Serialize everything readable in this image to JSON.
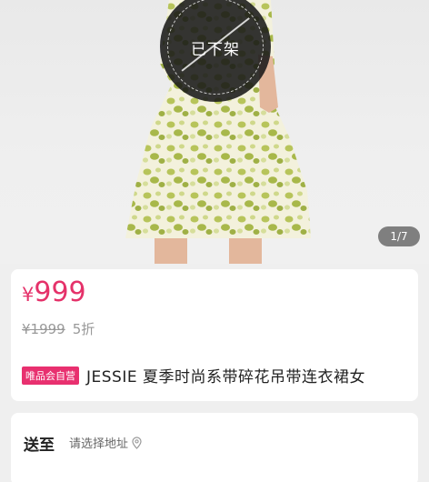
{
  "gallery": {
    "status_stamp": "已下架",
    "counter": "1/7"
  },
  "price": {
    "currency": "¥",
    "current": "999",
    "original": "¥1999",
    "discount": "5折"
  },
  "product": {
    "badge": "唯品会自营",
    "title": "JESSIE 夏季时尚系带碎花吊带连衣裙女"
  },
  "shipping": {
    "label": "送至",
    "address_placeholder": "请选择地址"
  },
  "colors": {
    "accent": "#e5326a",
    "badge_bg": "#e8306f"
  }
}
